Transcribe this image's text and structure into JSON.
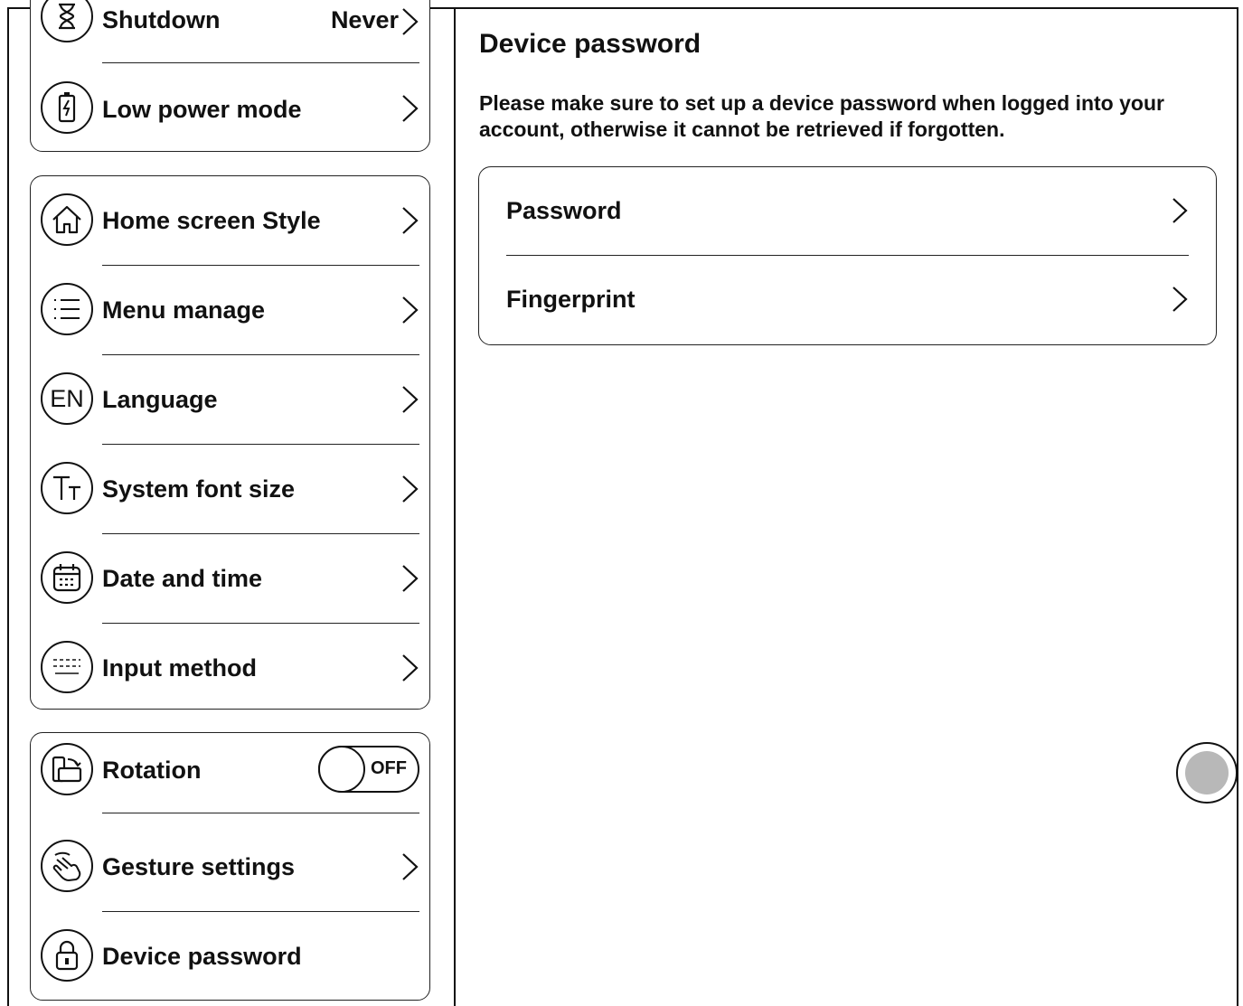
{
  "sidebar": {
    "group1": [
      {
        "label": "Shutdown",
        "value": "Never",
        "icon": "hourglass-icon"
      },
      {
        "label": "Low power mode",
        "icon": "battery-icon"
      }
    ],
    "group2": [
      {
        "label": "Home screen Style",
        "icon": "home-icon"
      },
      {
        "label": "Menu manage",
        "icon": "list-icon"
      },
      {
        "label": "Language",
        "icon": "language-icon",
        "icon_text": "EN"
      },
      {
        "label": "System font size",
        "icon": "font-size-icon"
      },
      {
        "label": "Date and time",
        "icon": "calendar-icon"
      },
      {
        "label": "Input method",
        "icon": "keyboard-icon"
      }
    ],
    "group3": [
      {
        "label": "Rotation",
        "icon": "rotation-icon",
        "toggle_state": "OFF"
      },
      {
        "label": "Gesture settings",
        "icon": "gesture-icon"
      },
      {
        "label": "Device password",
        "icon": "lock-icon"
      }
    ]
  },
  "main": {
    "title": "Device password",
    "description": "Please make sure to set up a device password when logged into your account, otherwise it cannot be retrieved if forgotten.",
    "options": [
      {
        "label": "Password"
      },
      {
        "label": "Fingerprint"
      }
    ]
  }
}
